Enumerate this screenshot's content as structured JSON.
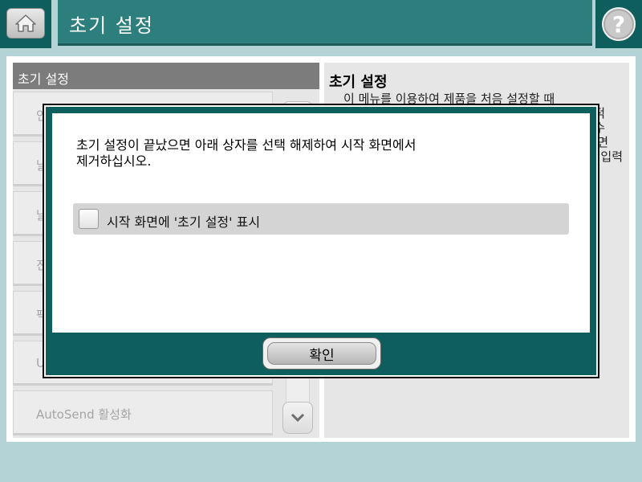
{
  "header": {
    "title": "초기 설정",
    "home_icon": "home-icon",
    "help_icon": "help-icon",
    "help_glyph": "?"
  },
  "left_panel": {
    "title": "초기 설정",
    "items": [
      {
        "label": "인"
      },
      {
        "label": "날"
      },
      {
        "label": "날"
      },
      {
        "label": "진"
      },
      {
        "label": "팩"
      },
      {
        "label": "U"
      },
      {
        "label": "AutoSend 활성화"
      }
    ],
    "scroll_up_icon": "chevron-up-icon",
    "scroll_down_icon": "chevron-down-icon"
  },
  "right_panel": {
    "title": "초기 설정",
    "description_lines": [
      "이 메뉴를 이용하여 제품을 처음 설정할 때",
      "적",
      "수",
      "면",
      "입력"
    ]
  },
  "modal": {
    "message_line1": "초기 설정이 끝났으면 아래 상자를 선택 해제하여 시작 화면에서",
    "message_line2": "제거하십시오.",
    "checkbox_label": "시작 화면에 '초기 설정' 표시",
    "checkbox_checked": false,
    "ok_label": "확인"
  },
  "colors": {
    "header_teal": "#2d7f7d",
    "dark_teal": "#0f5e5e",
    "background": "#b3d3d6"
  }
}
